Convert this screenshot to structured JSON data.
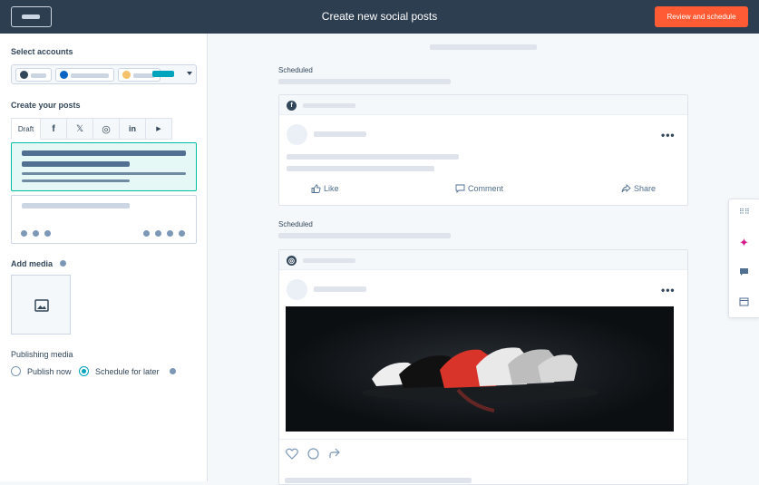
{
  "header": {
    "title": "Create new social posts",
    "review_label": "Review and schedule"
  },
  "sidebar": {
    "select_accounts_label": "Select accounts",
    "create_posts_label": "Create your posts",
    "tabs": [
      {
        "label": "Draft"
      },
      {
        "icon": "facebook-icon",
        "glyph": "f"
      },
      {
        "icon": "x-icon",
        "glyph": "𝕏"
      },
      {
        "icon": "instagram-icon",
        "glyph": "◎"
      },
      {
        "icon": "linkedin-icon",
        "glyph": "in"
      },
      {
        "icon": "youtube-icon",
        "glyph": "▶"
      }
    ],
    "add_media_label": "Add media",
    "publishing_media_label": "Publishing media",
    "publish_now_label": "Publish now",
    "schedule_later_label": "Schedule for later",
    "schedule_later_selected": true
  },
  "feed": {
    "post1": {
      "status": "Scheduled",
      "network_icon": "facebook-icon",
      "network_glyph": "f",
      "more": "•••",
      "like_label": "Like",
      "comment_label": "Comment",
      "share_label": "Share"
    },
    "post2": {
      "status": "Scheduled",
      "network_icon": "instagram-icon",
      "network_glyph": "◎",
      "more": "•••"
    }
  },
  "colors": {
    "header_bg": "#2d3e50",
    "accent_orange": "#ff5c35",
    "accent_teal": "#00bda5",
    "selected_bg": "#e5f8f6"
  }
}
